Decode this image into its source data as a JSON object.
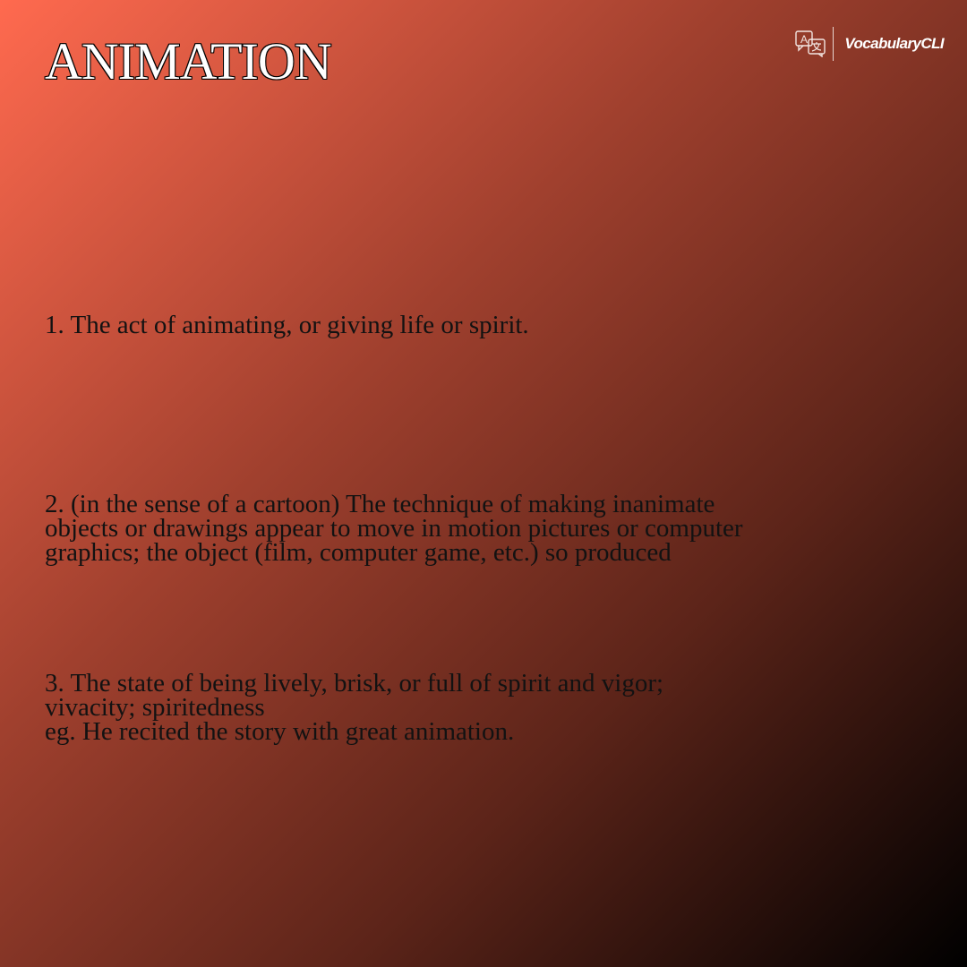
{
  "card": {
    "word": "ANIMATION",
    "brand": {
      "name": "VocabularyCLI",
      "icon": "translate-icon"
    },
    "definitions": [
      {
        "text": "1. The act of animating, or giving life or spirit."
      },
      {
        "text": "2. (in the sense of a cartoon) The technique of making inanimate\nobjects or drawings appear to move in motion pictures or computer\ngraphics; the object (film, computer game, etc.) so produced"
      },
      {
        "text": "3. The state of being lively, brisk, or full of spirit and vigor;\nvivacity; spiritedness\n eg. He recited the story with great animation."
      }
    ]
  }
}
